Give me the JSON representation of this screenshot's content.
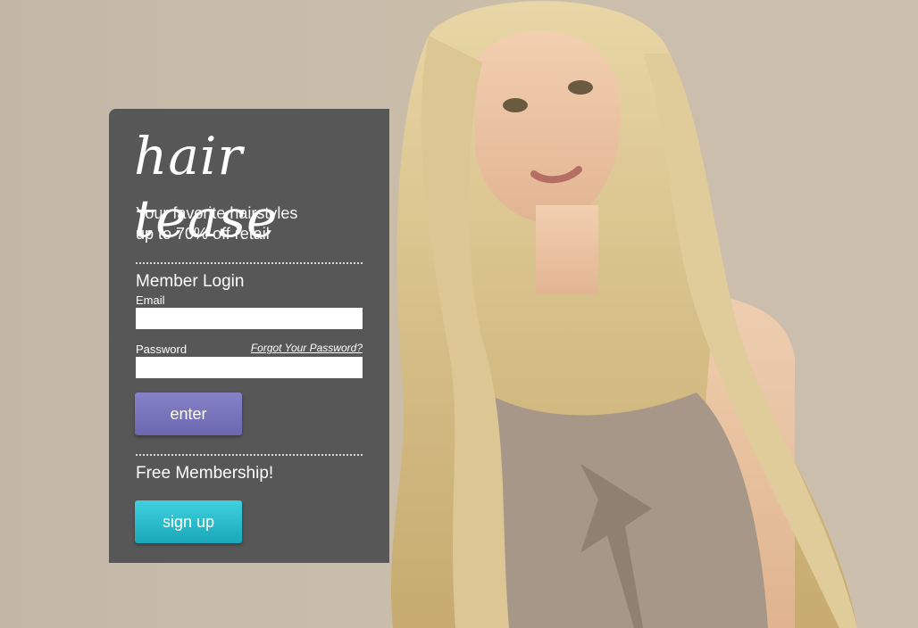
{
  "brand": {
    "logo_text": "hair tease"
  },
  "tagline": {
    "line1": "Your favorite hairstyles",
    "line2": "up to 70% off retail"
  },
  "login": {
    "title": "Member Login",
    "email_label": "Email",
    "email_value": "",
    "password_label": "Password",
    "password_value": "",
    "forgot_link": "Forgot Your Password?",
    "enter_button": "enter"
  },
  "signup": {
    "title": "Free Membership!",
    "button": "sign up"
  },
  "colors": {
    "panel": "#575757",
    "enter_button": "#7874bc",
    "signup_button": "#22b4c4",
    "background": "#c8bcaa"
  }
}
